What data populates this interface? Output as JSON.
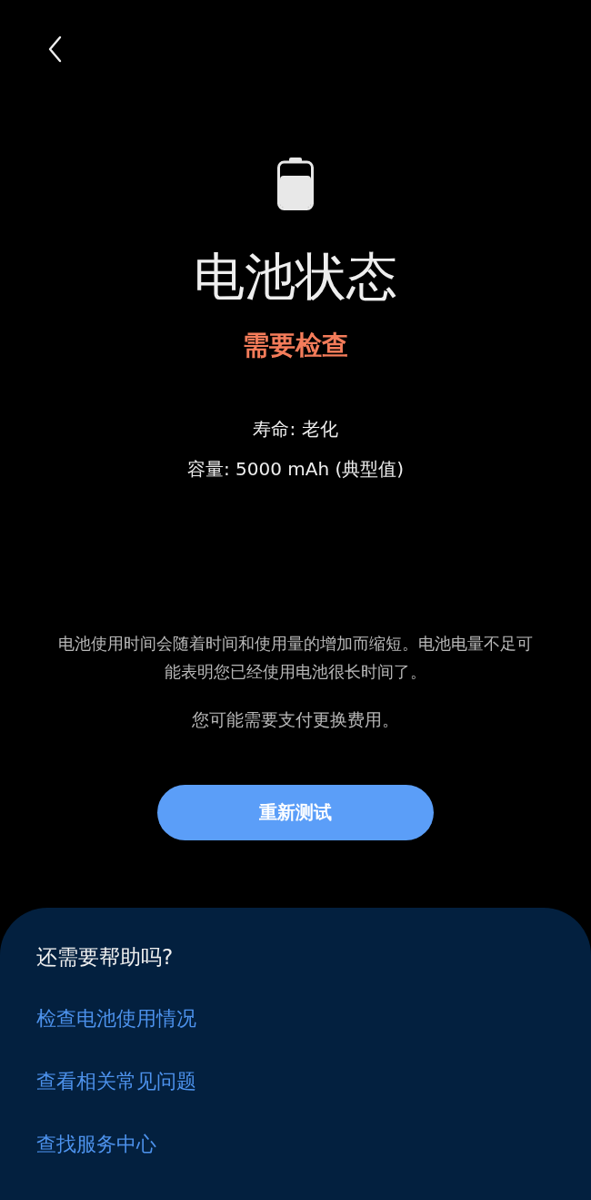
{
  "header": {
    "title": "电池状态",
    "status": "需要检查",
    "details": [
      "寿命: 老化",
      "容量: 5000 mAh (典型值)"
    ]
  },
  "description": "电池使用时间会随着时间和使用量的增加而缩短。电池电量不足可能表明您已经使用电池很长时间了。",
  "note": "您可能需要支付更换费用。",
  "button": "重新测试",
  "help": {
    "title": "还需要帮助吗?",
    "links": [
      "检查电池使用情况",
      "查看相关常见问题",
      "查找服务中心"
    ]
  }
}
